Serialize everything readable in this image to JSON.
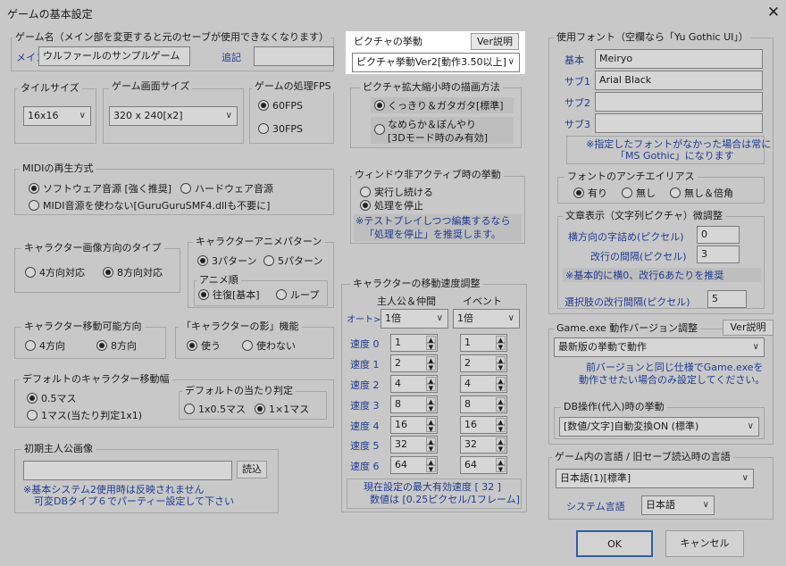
{
  "window": {
    "title": "ゲームの基本設定",
    "close": "✕"
  },
  "game_name": {
    "title": "ゲーム名（メイン部を変更すると元のセーブが使用できなくなります）",
    "main_label": "メイン",
    "main_value": "ウルファールのサンプルゲーム",
    "sub_label": "追記",
    "sub_value": ""
  },
  "picture_behavior": {
    "title": "ピクチャの挙動",
    "ver_button": "Ver説明",
    "selected": "ピクチャ挙動Ver2[動作3.50以上]"
  },
  "tile_size": {
    "title": "タイルサイズ",
    "selected": "16x16"
  },
  "screen_size": {
    "title": "ゲーム画面サイズ",
    "selected": "320 x 240[x2]"
  },
  "fps": {
    "title": "ゲームの処理FPS",
    "opt1": "60FPS",
    "opt2": "30FPS"
  },
  "scaling": {
    "title": "ピクチャ拡大縮小時の描画方法",
    "opt1": "くっきり＆ガタガタ[標準]",
    "opt2_line1": "なめらか＆ぼんやり",
    "opt2_line2": "[3Dモード時のみ有効]"
  },
  "midi": {
    "title": "MIDIの再生方式",
    "opt1": "ソフトウェア音源 [強く推奨]",
    "opt2": "ハードウェア音源",
    "opt3": "MIDI音源を使わない[GuruGuruSMF4.dllも不要に]"
  },
  "inactive": {
    "title": "ウィンドウ非アクティブ時の挙動",
    "opt1": "実行し続ける",
    "opt2": "処理を停止",
    "note1": "※テストプレイしつつ編集するなら",
    "note2": "「処理を停止」を推奨します。"
  },
  "char_dir": {
    "title": "キャラクター画像方向のタイプ",
    "opt1": "4方向対応",
    "opt2": "8方向対応"
  },
  "anim_pattern": {
    "title": "キャラクターアニメパターン",
    "opt1": "3パターン",
    "opt2": "5パターン",
    "order_title": "アニメ順",
    "order1": "往復[基本]",
    "order2": "ループ"
  },
  "move_dir": {
    "title": "キャラクター移動可能方向",
    "opt1": "4方向",
    "opt2": "8方向"
  },
  "shadow": {
    "title": "「キャラクターの影」機能",
    "opt1": "使う",
    "opt2": "使わない"
  },
  "move_width": {
    "title": "デフォルトのキャラクター移動幅",
    "opt1": "0.5マス",
    "opt2": "1マス(当たり判定1x1)"
  },
  "hitbox": {
    "title": "デフォルトの当たり判定",
    "opt1": "1x0.5マス",
    "opt2": "1×1マス"
  },
  "initial_image": {
    "title": "初期主人公画像",
    "load_button": "読込",
    "note1": "※基本システム2使用時は反映されません",
    "note2": "可変DBタイプ６でパーティー設定して下さい"
  },
  "speed": {
    "title": "キャラクターの移動速度調整",
    "col_hero": "主人公＆仲間",
    "col_event": "イベント",
    "auto_label": "オート>",
    "auto_hero": "1倍",
    "auto_event": "1倍",
    "rows": [
      {
        "label": "速度 0",
        "hero": "1",
        "event": "1"
      },
      {
        "label": "速度 1",
        "hero": "2",
        "event": "2"
      },
      {
        "label": "速度 2",
        "hero": "4",
        "event": "4"
      },
      {
        "label": "速度 3",
        "hero": "8",
        "event": "8"
      },
      {
        "label": "速度 4",
        "hero": "16",
        "event": "16"
      },
      {
        "label": "速度 5",
        "hero": "32",
        "event": "32"
      },
      {
        "label": "速度 6",
        "hero": "64",
        "event": "64"
      }
    ],
    "note1": "現在設定の最大有効速度 [ 32 ]",
    "note2": "数値は [0.25ピクセル/1フレーム]"
  },
  "fonts": {
    "title": "使用フォント（空欄なら「Yu Gothic UI」）",
    "base_label": "基本",
    "base_value": "Meiryo",
    "sub1_label": "サブ1",
    "sub1_value": "Arial Black",
    "sub2_label": "サブ2",
    "sub2_value": "",
    "sub3_label": "サブ3",
    "sub3_value": "",
    "note1": "※指定したフォントがなかった場合は常に",
    "note2": "「MS Gothic」になります"
  },
  "antialias": {
    "title": "フォントのアンチエイリアス",
    "opt1": "有り",
    "opt2": "無し",
    "opt3": "無し＆倍角"
  },
  "text_display": {
    "title": "文章表示（文字列ピクチャ）微調整",
    "hspace_label": "横方向の字詰め(ピクセル)",
    "hspace_value": "0",
    "lspace_label": "改行の間隔(ピクセル)",
    "lspace_value": "3",
    "note": "※基本的に横0、改行6あたりを推奨",
    "choice_label": "選択肢の改行間隔(ピクセル)",
    "choice_value": "5"
  },
  "game_exe": {
    "title": "Game.exe 動作バージョン調整",
    "ver_button": "Ver説明",
    "selected": "最新版の挙動で動作",
    "note1": "前バージョンと同じ仕様でGame.exeを",
    "note2": "動作させたい場合のみ設定してください。"
  },
  "db_op": {
    "title": "DB操作(代入)時の挙動",
    "selected": "[数値/文字]自動変換ON (標準)"
  },
  "language": {
    "title": "ゲーム内の言語 / 旧セーブ読込時の言語",
    "selected": "日本語(1)[標準]",
    "sys_label": "システム言語",
    "sys_value": "日本語"
  },
  "buttons": {
    "ok": "OK",
    "cancel": "キャンセル"
  },
  "icons": {
    "dropdown": "chevron-down-icon",
    "close": "close-icon",
    "spin_up": "▲",
    "spin_down": "▼"
  }
}
